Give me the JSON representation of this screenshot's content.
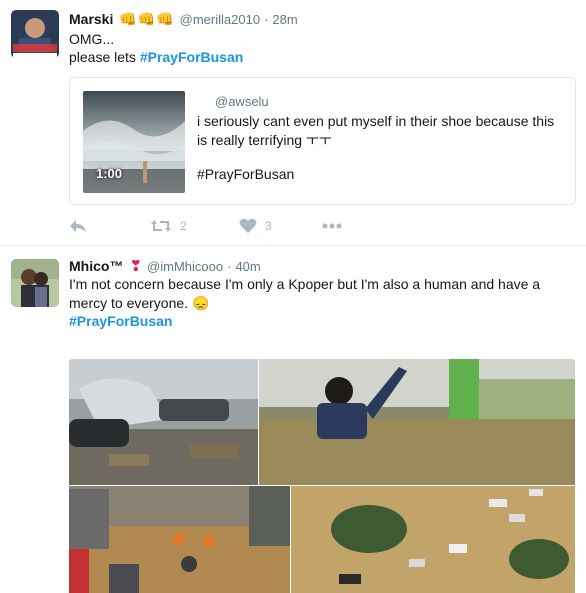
{
  "tweet1": {
    "name": "Marski",
    "emojis": "👊👊👊",
    "handle": "@merilla2010",
    "dot": "·",
    "time": "28m",
    "line1": "OMG...",
    "line2_prefix": "please lets ",
    "hashtag": "#PrayForBusan",
    "quote": {
      "handle": "@awselu",
      "text": "i seriously cant even put myself in their shoe because this is really terrifying ㅜㅜ",
      "hashtag": "#PrayForBusan",
      "duration": "1:00"
    },
    "retweets": "2",
    "likes": "3"
  },
  "tweet2": {
    "name": "Mhico™",
    "heart": "❣",
    "handle": "@imMhicooo",
    "dot": "·",
    "time": "40m",
    "text": "I'm not concern because I'm only a Kpoper but I'm also a human and have a mercy to everyone. 😞",
    "hashtag": "#PrayForBusan"
  },
  "colors": {
    "link": "#1b95e0",
    "muted": "#657786",
    "icon": "#aab8c2",
    "heart": "#e0245e"
  }
}
